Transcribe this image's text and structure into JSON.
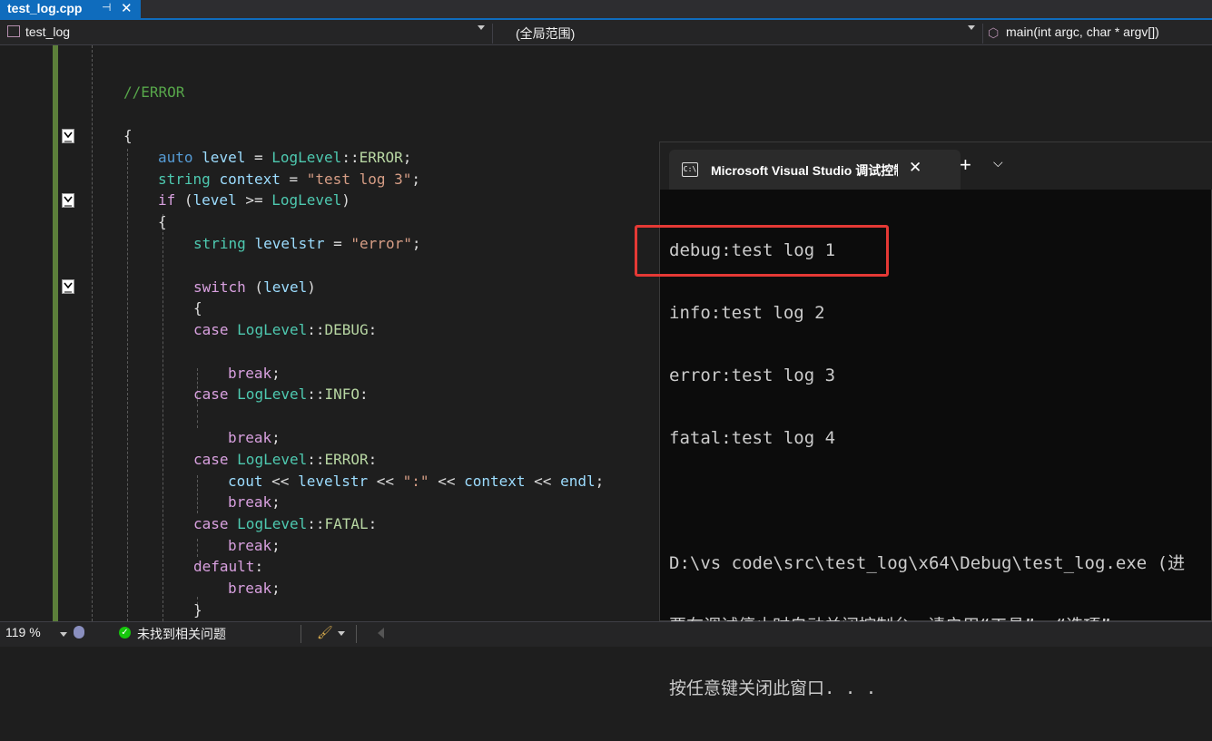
{
  "tab": {
    "title": "test_log.cpp",
    "pin": "⊣",
    "close": "✕"
  },
  "nav": {
    "project": "test_log",
    "scope": "(全局范围)",
    "member": "main(int argc, char * argv[])"
  },
  "code": [
    [
      [
        "cm",
        "//ERROR"
      ]
    ],
    [
      [
        "pl",
        "{"
      ]
    ],
    [
      [
        "kw",
        "auto"
      ],
      [
        "pl",
        " "
      ],
      [
        "id",
        "level"
      ],
      [
        "pl",
        " = "
      ],
      [
        "ty",
        "LogLevel"
      ],
      [
        "pl",
        "::"
      ],
      [
        "en",
        "ERROR"
      ],
      [
        "pl",
        ";"
      ]
    ],
    [
      [
        "ty",
        "string"
      ],
      [
        "pl",
        " "
      ],
      [
        "id",
        "context"
      ],
      [
        "pl",
        " = "
      ],
      [
        "str",
        "\"test log 3\""
      ],
      [
        "pl",
        ";"
      ]
    ],
    [
      [
        "kwp",
        "if"
      ],
      [
        "pl",
        " ("
      ],
      [
        "id",
        "level"
      ],
      [
        "pl",
        " >= "
      ],
      [
        "ty",
        "LogLevel"
      ],
      [
        "pl",
        ")"
      ]
    ],
    [
      [
        "pl",
        "{"
      ]
    ],
    [
      [
        "ty",
        "string"
      ],
      [
        "pl",
        " "
      ],
      [
        "id",
        "levelstr"
      ],
      [
        "pl",
        " = "
      ],
      [
        "str",
        "\"error\""
      ],
      [
        "pl",
        ";"
      ]
    ],
    [
      [
        "kwp",
        "switch"
      ],
      [
        "pl",
        " ("
      ],
      [
        "id",
        "level"
      ],
      [
        "pl",
        ")"
      ]
    ],
    [
      [
        "pl",
        "{"
      ]
    ],
    [
      [
        "kwp",
        "case"
      ],
      [
        "pl",
        " "
      ],
      [
        "ty",
        "LogLevel"
      ],
      [
        "pl",
        "::"
      ],
      [
        "en",
        "DEBUG"
      ],
      [
        "pl",
        ":"
      ]
    ],
    [
      [
        "kwp",
        "break"
      ],
      [
        "pl",
        ";"
      ]
    ],
    [
      [
        "kwp",
        "case"
      ],
      [
        "pl",
        " "
      ],
      [
        "ty",
        "LogLevel"
      ],
      [
        "pl",
        "::"
      ],
      [
        "en",
        "INFO"
      ],
      [
        "pl",
        ":"
      ]
    ],
    [
      [
        "kwp",
        "break"
      ],
      [
        "pl",
        ";"
      ]
    ],
    [
      [
        "kwp",
        "case"
      ],
      [
        "pl",
        " "
      ],
      [
        "ty",
        "LogLevel"
      ],
      [
        "pl",
        "::"
      ],
      [
        "en",
        "ERROR"
      ],
      [
        "pl",
        ":"
      ]
    ],
    [
      [
        "id",
        "cout"
      ],
      [
        "pl",
        " << "
      ],
      [
        "id",
        "levelstr"
      ],
      [
        "pl",
        " << "
      ],
      [
        "str",
        "\":\""
      ],
      [
        "pl",
        " << "
      ],
      [
        "id",
        "context"
      ],
      [
        "pl",
        " << "
      ],
      [
        "id",
        "endl"
      ],
      [
        "pl",
        ";"
      ]
    ],
    [
      [
        "kwp",
        "break"
      ],
      [
        "pl",
        ";"
      ]
    ],
    [
      [
        "kwp",
        "case"
      ],
      [
        "pl",
        " "
      ],
      [
        "ty",
        "LogLevel"
      ],
      [
        "pl",
        "::"
      ],
      [
        "en",
        "FATAL"
      ],
      [
        "pl",
        ":"
      ]
    ],
    [
      [
        "kwp",
        "break"
      ],
      [
        "pl",
        ";"
      ]
    ],
    [
      [
        "kwp",
        "default"
      ],
      [
        "pl",
        ":"
      ]
    ],
    [
      [
        "kwp",
        "break"
      ],
      [
        "pl",
        ";"
      ]
    ],
    [
      [
        "pl",
        "}"
      ]
    ]
  ],
  "console": {
    "tab_title": "Microsoft Visual Studio 调试控制台",
    "icon_text": "C:\\",
    "close": "✕",
    "new_tab": "+",
    "dropdown": "⌵",
    "lines": [
      "debug:test log 1",
      "info:test log 2",
      "error:test log 3",
      "fatal:test log 4",
      "",
      "D:\\vs code\\src\\test_log\\x64\\Debug\\test_log.exe (进",
      "要在调试停止时自动关闭控制台，请启用“工具”->“选项”",
      "按任意键关闭此窗口. . ."
    ]
  },
  "status": {
    "zoom": "119 %",
    "issues": "未找到相关问题",
    "check": "✓",
    "brush": "🖌"
  },
  "colors": {
    "accent": "#0f6cbd",
    "highlight": "#e53935",
    "gutter_change": "#5c7f3a"
  }
}
